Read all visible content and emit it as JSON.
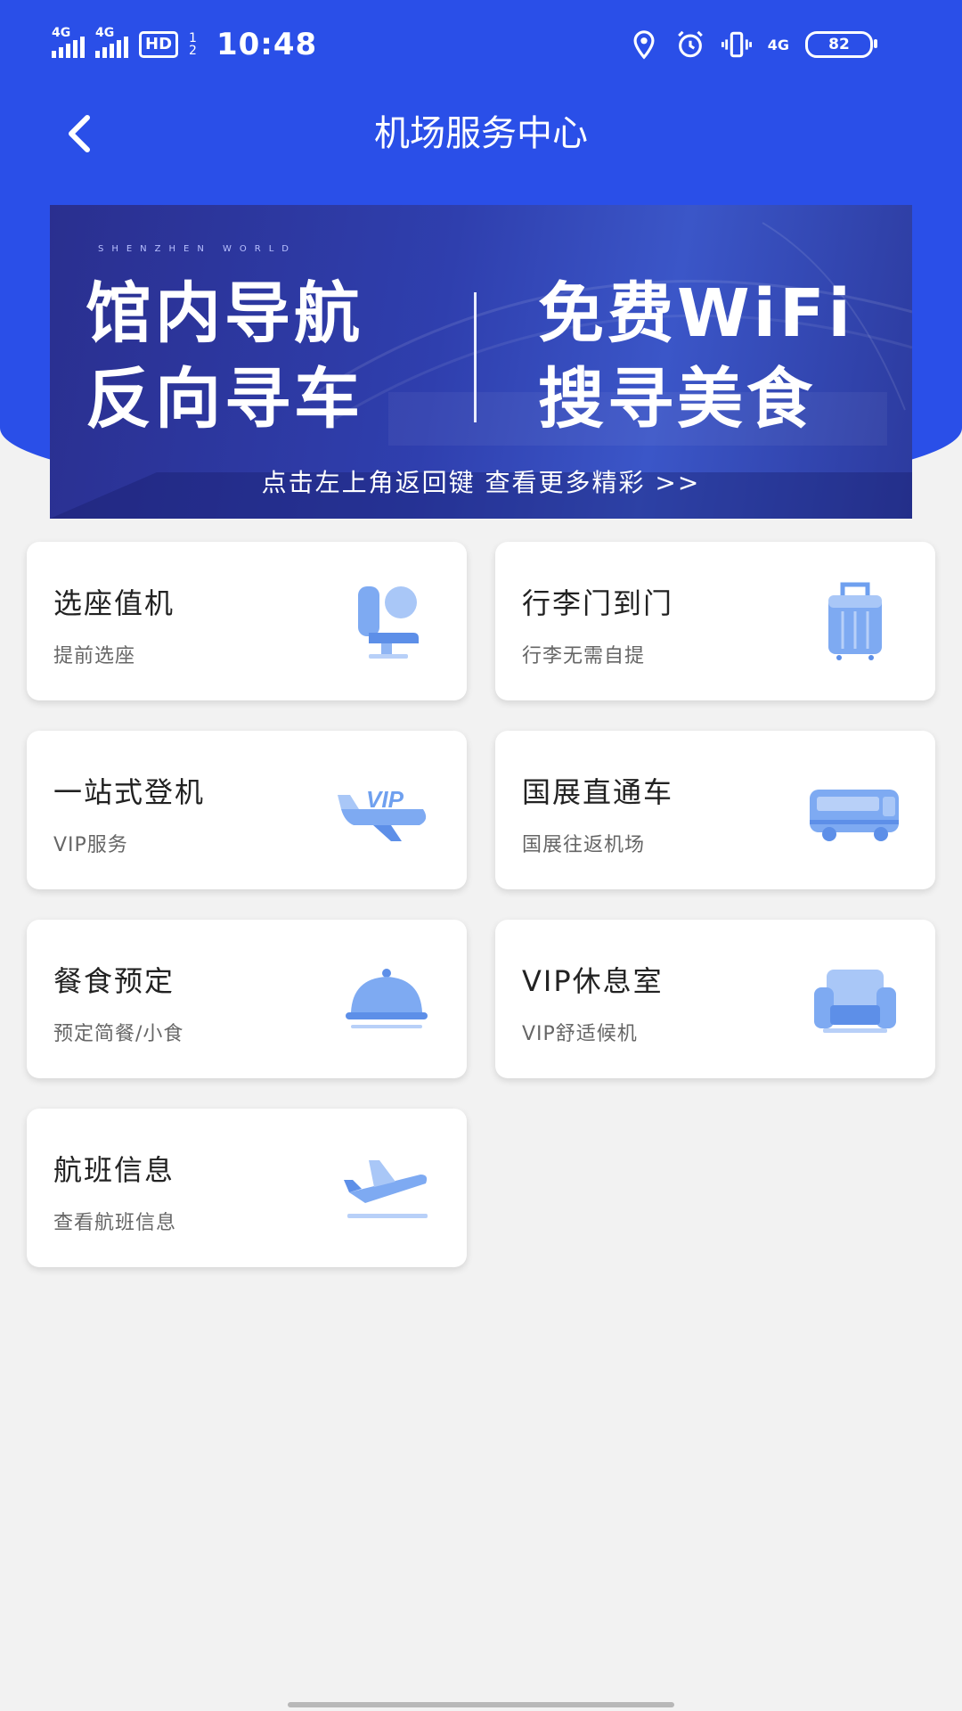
{
  "status_bar": {
    "sim1": "4G",
    "sim2": "4G",
    "hd": "HD",
    "hd_fraction": [
      "1",
      "2"
    ],
    "time": "10:48",
    "network": "4G",
    "battery": "82"
  },
  "nav": {
    "title": "机场服务中心"
  },
  "banner": {
    "tag": "SHENZHEN WORLD",
    "left_line1": "馆内导航",
    "left_line2": "反向寻车",
    "right_line1": "免费WiFi",
    "right_line2": "搜寻美食",
    "subtitle": "点击左上角返回键 查看更多精彩 >>"
  },
  "services": [
    {
      "title": "选座值机",
      "subtitle": "提前选座",
      "icon": "seat-icon"
    },
    {
      "title": "行李门到门",
      "subtitle": "行李无需自提",
      "icon": "luggage-icon"
    },
    {
      "title": "一站式登机",
      "subtitle": "VIP服务",
      "icon": "vip-plane-icon"
    },
    {
      "title": "国展直通车",
      "subtitle": "国展往返机场",
      "icon": "bus-icon"
    },
    {
      "title": "餐食预定",
      "subtitle": "预定简餐/小食",
      "icon": "food-cloche-icon"
    },
    {
      "title": "VIP休息室",
      "subtitle": "VIP舒适候机",
      "icon": "sofa-icon"
    },
    {
      "title": "航班信息",
      "subtitle": "查看航班信息",
      "icon": "departure-plane-icon"
    }
  ],
  "colors": {
    "header": "#2a4fe8",
    "background": "#f2f2f2",
    "icon_blue": "#6fa0ef"
  }
}
